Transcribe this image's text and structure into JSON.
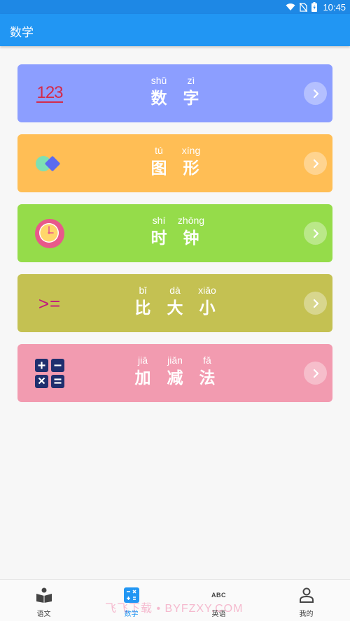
{
  "status_bar": {
    "time": "10:45"
  },
  "app_bar": {
    "title": "数学"
  },
  "cards": [
    {
      "id": "numbers",
      "color": "#8c9eff",
      "icon": "numbers-123-icon",
      "icon_text": "123",
      "chars": [
        {
          "pinyin": "shǔ",
          "hanzi": "数"
        },
        {
          "pinyin": "zì",
          "hanzi": "字"
        }
      ]
    },
    {
      "id": "shapes",
      "color": "#ffbe55",
      "icon": "shapes-icon",
      "chars": [
        {
          "pinyin": "tú",
          "hanzi": "图"
        },
        {
          "pinyin": "xíng",
          "hanzi": "形"
        }
      ]
    },
    {
      "id": "clock",
      "color": "#95dc4a",
      "icon": "clock-icon",
      "chars": [
        {
          "pinyin": "shí",
          "hanzi": "时"
        },
        {
          "pinyin": "zhōng",
          "hanzi": "钟"
        }
      ]
    },
    {
      "id": "compare",
      "color": "#c4c152",
      "icon": "greater-equal-icon",
      "icon_text": ">=",
      "chars": [
        {
          "pinyin": "bǐ",
          "hanzi": "比"
        },
        {
          "pinyin": "dà",
          "hanzi": "大"
        },
        {
          "pinyin": "xiǎo",
          "hanzi": "小"
        }
      ]
    },
    {
      "id": "arithmetic",
      "color": "#f29bb0",
      "icon": "calculator-icon",
      "chars": [
        {
          "pinyin": "jiā",
          "hanzi": "加"
        },
        {
          "pinyin": "jiǎn",
          "hanzi": "减"
        },
        {
          "pinyin": "fǎ",
          "hanzi": "法"
        }
      ]
    }
  ],
  "bottom_nav": {
    "items": [
      {
        "label": "语文",
        "icon": "book-icon",
        "active": false
      },
      {
        "label": "数学",
        "icon": "math-icon",
        "active": true
      },
      {
        "label": "英语",
        "icon": "abc-icon",
        "icon_text": "ABC",
        "active": false
      },
      {
        "label": "我的",
        "icon": "person-icon",
        "active": false
      }
    ]
  },
  "watermark": "飞飞下载 • BYFZXY.COM",
  "colors": {
    "app_bar": "#2196f3",
    "status_bar": "#1e88e5",
    "nav_active": "#2196f3"
  }
}
